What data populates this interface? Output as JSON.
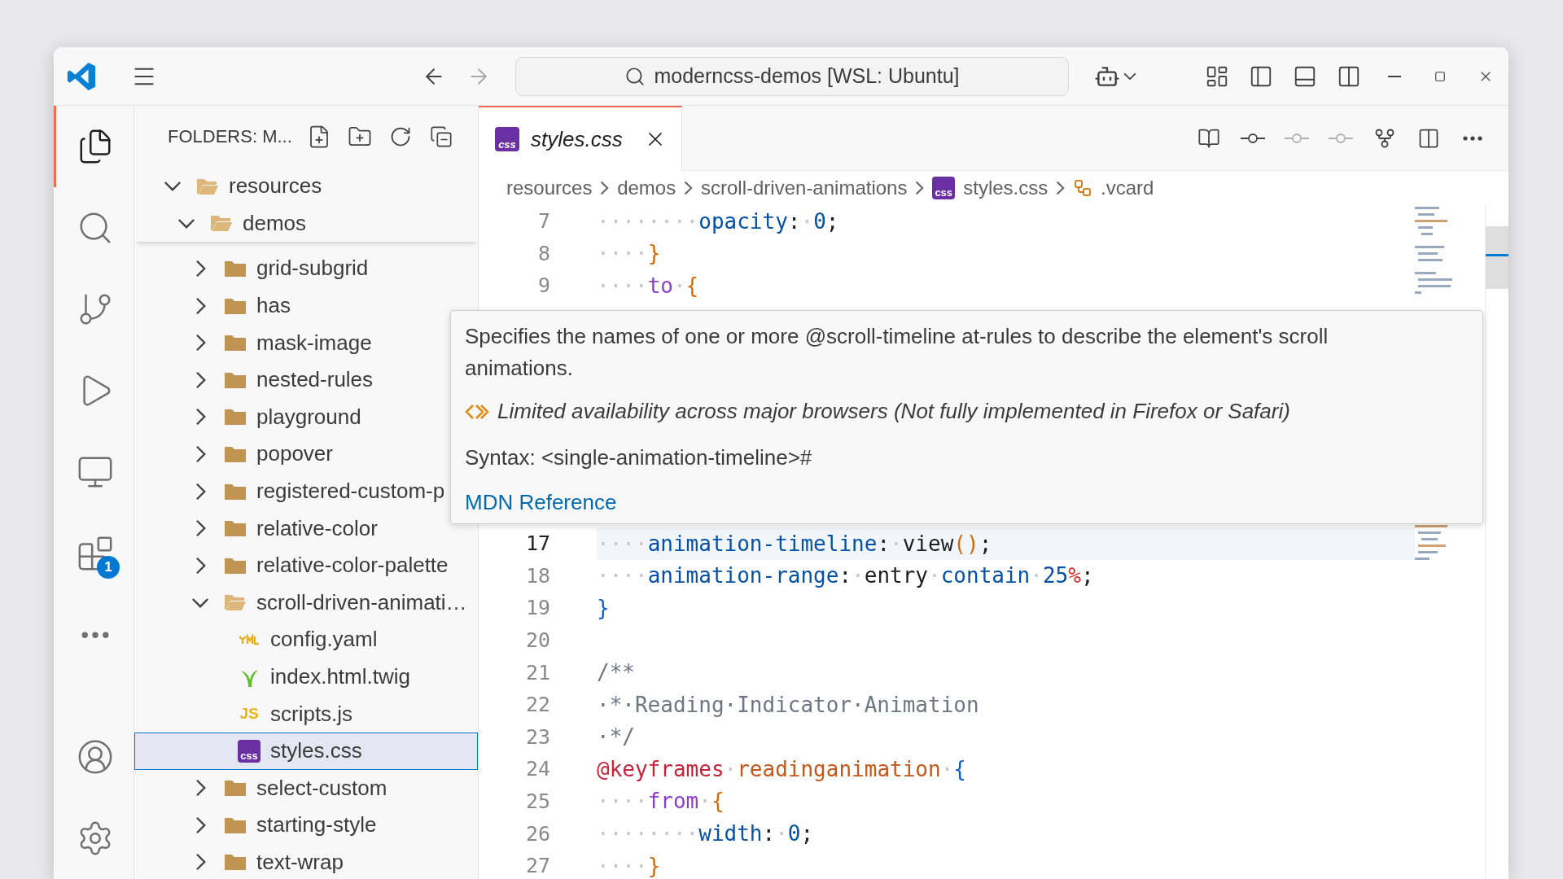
{
  "window": {
    "title": "moderncss-demos [WSL: Ubuntu]"
  },
  "activity_bar": {
    "items": [
      {
        "kind": "explorer",
        "selected": true
      },
      {
        "kind": "search",
        "selected": false
      },
      {
        "kind": "source-control",
        "selected": false
      },
      {
        "kind": "run-debug",
        "selected": false
      },
      {
        "kind": "remote",
        "selected": false
      },
      {
        "kind": "extensions",
        "selected": false,
        "badge": "1"
      },
      {
        "kind": "more",
        "selected": false
      }
    ],
    "bottom": [
      {
        "kind": "account"
      },
      {
        "kind": "settings"
      }
    ]
  },
  "sidebar": {
    "title": "FOLDERS: M...",
    "tree": [
      {
        "label": "resources",
        "kind": "folder",
        "expanded": true,
        "selected": false,
        "children": [
          {
            "label": "demos",
            "kind": "folder",
            "expanded": true,
            "selected": false,
            "children": [
              {
                "label": "grid-subgrid",
                "kind": "folder",
                "expanded": false,
                "selected": false
              },
              {
                "label": "has",
                "kind": "folder",
                "expanded": false,
                "selected": false
              },
              {
                "label": "mask-image",
                "kind": "folder",
                "expanded": false,
                "selected": false
              },
              {
                "label": "nested-rules",
                "kind": "folder",
                "expanded": false,
                "selected": false
              },
              {
                "label": "playground",
                "kind": "folder",
                "expanded": false,
                "selected": false
              },
              {
                "label": "popover",
                "kind": "folder",
                "expanded": false,
                "selected": false
              },
              {
                "label": "registered-custom-p",
                "kind": "folder",
                "expanded": false,
                "selected": false
              },
              {
                "label": "relative-color",
                "kind": "folder",
                "expanded": false,
                "selected": false
              },
              {
                "label": "relative-color-palette",
                "kind": "folder",
                "expanded": false,
                "selected": false
              },
              {
                "label": "scroll-driven-animati…",
                "kind": "folder",
                "expanded": true,
                "selected": false,
                "children": [
                  {
                    "label": "config.yaml",
                    "kind": "yaml",
                    "selected": false
                  },
                  {
                    "label": "index.html.twig",
                    "kind": "twig",
                    "selected": false
                  },
                  {
                    "label": "scripts.js",
                    "kind": "js",
                    "icon_label": "JS",
                    "selected": false
                  },
                  {
                    "label": "styles.css",
                    "kind": "css",
                    "icon_label": "css",
                    "selected": true
                  }
                ]
              },
              {
                "label": "select-custom",
                "kind": "folder",
                "expanded": false,
                "selected": false
              },
              {
                "label": "starting-style",
                "kind": "folder",
                "expanded": false,
                "selected": false
              },
              {
                "label": "text-wrap",
                "kind": "folder",
                "expanded": false,
                "selected": false
              }
            ]
          }
        ]
      }
    ]
  },
  "editor": {
    "tabs": [
      {
        "label": "styles.css",
        "icon_label": "css",
        "selected": true,
        "preview": true
      }
    ],
    "breadcrumbs": [
      {
        "label": "resources",
        "kind": "folder"
      },
      {
        "label": "demos",
        "kind": "folder"
      },
      {
        "label": "scroll-driven-animations",
        "kind": "folder"
      },
      {
        "label": "styles.css",
        "kind": "css",
        "icon_label": "css"
      },
      {
        "label": ".vcard",
        "kind": "selector"
      }
    ],
    "lines": [
      {
        "number": "7",
        "current": false,
        "tokens": [
          {
            "text": "········",
            "kind": "ws"
          },
          {
            "text": "opacity",
            "kind": "property"
          },
          {
            "text": ":",
            "kind": "punct"
          },
          {
            "text": "·",
            "kind": "ws"
          },
          {
            "text": "0",
            "kind": "number"
          },
          {
            "text": ";",
            "kind": "punct"
          }
        ]
      },
      {
        "number": "8",
        "current": false,
        "tokens": [
          {
            "text": "····",
            "kind": "ws"
          },
          {
            "text": "}",
            "kind": "bracket2"
          }
        ]
      },
      {
        "number": "9",
        "current": false,
        "tokens": [
          {
            "text": "····",
            "kind": "ws"
          },
          {
            "text": "to",
            "kind": "keyword"
          },
          {
            "text": "·",
            "kind": "ws"
          },
          {
            "text": "{",
            "kind": "bracket2"
          }
        ]
      },
      {
        "number": "17",
        "current": true,
        "tokens": [
          {
            "text": "····",
            "kind": "ws"
          },
          {
            "text": "animation-timeline",
            "kind": "property"
          },
          {
            "text": ":",
            "kind": "punct"
          },
          {
            "text": "·",
            "kind": "ws"
          },
          {
            "text": "view",
            "kind": "plain"
          },
          {
            "text": "()",
            "kind": "bracket2"
          },
          {
            "text": ";",
            "kind": "punct"
          }
        ]
      },
      {
        "number": "18",
        "current": false,
        "tokens": [
          {
            "text": "····",
            "kind": "ws"
          },
          {
            "text": "animation-range",
            "kind": "property"
          },
          {
            "text": ":",
            "kind": "punct"
          },
          {
            "text": "·",
            "kind": "ws"
          },
          {
            "text": "entry",
            "kind": "plain"
          },
          {
            "text": "·",
            "kind": "ws"
          },
          {
            "text": "contain",
            "kind": "value"
          },
          {
            "text": "·",
            "kind": "ws"
          },
          {
            "text": "25",
            "kind": "number"
          },
          {
            "text": "%",
            "kind": "unit"
          },
          {
            "text": ";",
            "kind": "punct"
          }
        ]
      },
      {
        "number": "19",
        "current": false,
        "tokens": [
          {
            "text": "}",
            "kind": "bracket1"
          }
        ]
      },
      {
        "number": "20",
        "current": false
      },
      {
        "number": "21",
        "current": false,
        "tokens": [
          {
            "text": "/**",
            "kind": "comment"
          }
        ]
      },
      {
        "number": "22",
        "current": false,
        "tokens": [
          {
            "text": "·*·Reading·Indicator·Animation",
            "kind": "comment"
          }
        ]
      },
      {
        "number": "23",
        "current": false,
        "tokens": [
          {
            "text": "·*/",
            "kind": "comment"
          }
        ]
      },
      {
        "number": "24",
        "current": false,
        "tokens": [
          {
            "text": "@keyframes",
            "kind": "atrule"
          },
          {
            "text": "·",
            "kind": "ws"
          },
          {
            "text": "readinganimation",
            "kind": "name"
          },
          {
            "text": "·",
            "kind": "ws"
          },
          {
            "text": "{",
            "kind": "bracket1"
          }
        ]
      },
      {
        "number": "25",
        "current": false,
        "tokens": [
          {
            "text": "····",
            "kind": "ws"
          },
          {
            "text": "from",
            "kind": "keyword"
          },
          {
            "text": "·",
            "kind": "ws"
          },
          {
            "text": "{",
            "kind": "bracket2"
          }
        ]
      },
      {
        "number": "26",
        "current": false,
        "tokens": [
          {
            "text": "········",
            "kind": "ws"
          },
          {
            "text": "width",
            "kind": "property"
          },
          {
            "text": ":",
            "kind": "punct"
          },
          {
            "text": "·",
            "kind": "ws"
          },
          {
            "text": "0",
            "kind": "number"
          },
          {
            "text": ";",
            "kind": "punct"
          }
        ]
      },
      {
        "number": "27",
        "current": false,
        "tokens": [
          {
            "text": "····",
            "kind": "ws"
          },
          {
            "text": "}",
            "kind": "bracket2"
          }
        ]
      }
    ],
    "hover": {
      "description": "Specifies the names of one or more @scroll-timeline at-rules to describe the element's scroll animations.",
      "availability": "Limited availability across major browsers (Not fully implemented in Firefox or Safari)",
      "syntax": "Syntax: <single-animation-timeline>#",
      "link": "MDN Reference"
    }
  }
}
